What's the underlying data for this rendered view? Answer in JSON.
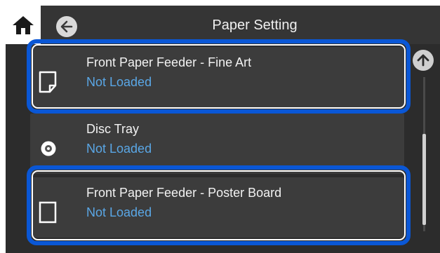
{
  "header": {
    "title": "Paper Setting",
    "home_icon": "home-icon",
    "back_icon": "back-arrow-icon"
  },
  "paper_sources": [
    {
      "name": "Front Paper Feeder - Fine Art",
      "status": "Not Loaded",
      "icon": "sheet-folded-corner-icon",
      "highlighted": true
    },
    {
      "name": "Disc Tray",
      "status": "Not Loaded",
      "icon": "disc-icon",
      "highlighted": false
    },
    {
      "name": "Front Paper Feeder - Poster Board",
      "status": "Not Loaded",
      "icon": "sheet-icon",
      "highlighted": true
    }
  ],
  "scroll": {
    "up_icon": "scroll-up-arrow-icon"
  },
  "colors": {
    "status_text": "#5aa7e6",
    "highlight": "#0a57d6",
    "background": "#2c2c2c",
    "list_item": "#3c3c3c"
  }
}
